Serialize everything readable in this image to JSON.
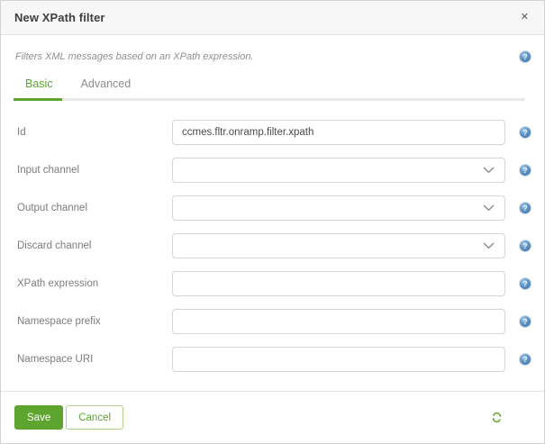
{
  "dialog": {
    "title": "New XPath filter",
    "description": "Filters XML messages based on an XPath expression."
  },
  "icons": {
    "close_glyph": "✕",
    "help_glyph": "?"
  },
  "tabs": [
    {
      "label": "Basic",
      "active": true
    },
    {
      "label": "Advanced",
      "active": false
    }
  ],
  "form": {
    "fields": [
      {
        "label": "Id",
        "type": "text",
        "value": "ccmes.fltr.onramp.filter.xpath"
      },
      {
        "label": "Input channel",
        "type": "select",
        "value": ""
      },
      {
        "label": "Output channel",
        "type": "select",
        "value": ""
      },
      {
        "label": "Discard channel",
        "type": "select",
        "value": ""
      },
      {
        "label": "XPath expression",
        "type": "text",
        "value": ""
      },
      {
        "label": "Namespace prefix",
        "type": "text",
        "value": ""
      },
      {
        "label": "Namespace URI",
        "type": "text",
        "value": ""
      }
    ]
  },
  "footer": {
    "save_label": "Save",
    "cancel_label": "Cancel"
  },
  "colors": {
    "accent_green": "#5da52f",
    "help_blue": "#4a80b4",
    "tab_inactive_gray": "#8c8c8c"
  }
}
